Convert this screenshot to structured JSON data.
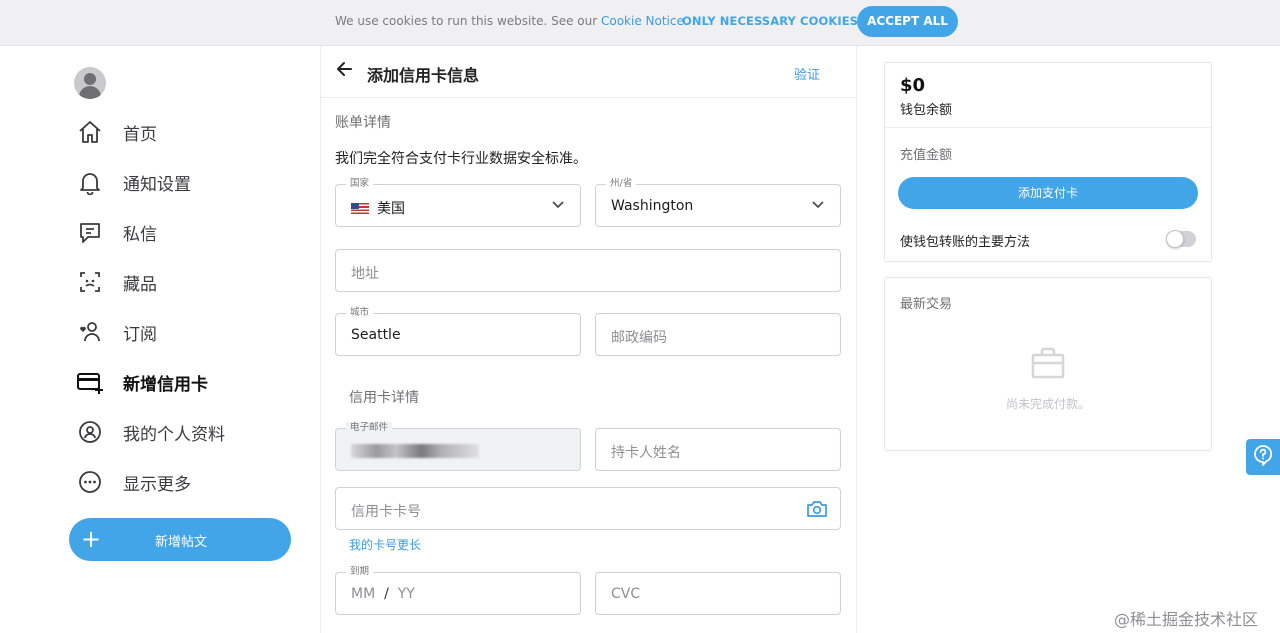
{
  "cookie_banner": {
    "message": "We use cookies to run this website. See our ",
    "notice_link": "Cookie Notice",
    "notice_suffix": ".",
    "only_necessary": "ONLY NECESSARY COOKIES",
    "accept_all": "ACCEPT ALL"
  },
  "sidebar": {
    "items": [
      {
        "label": "首页",
        "icon": "home-icon"
      },
      {
        "label": "通知设置",
        "icon": "bell-icon"
      },
      {
        "label": "私信",
        "icon": "message-icon"
      },
      {
        "label": "藏品",
        "icon": "collection-icon"
      },
      {
        "label": "订阅",
        "icon": "subscription-icon"
      },
      {
        "label": "新增信用卡",
        "icon": "credit-card-add-icon",
        "active": true
      },
      {
        "label": "我的个人资料",
        "icon": "profile-icon"
      },
      {
        "label": "显示更多",
        "icon": "more-icon"
      }
    ],
    "new_post": "新增帖文"
  },
  "main": {
    "title": "添加信用卡信息",
    "verify": "验证",
    "billing_section": "账单详情",
    "compliance": "我们完全符合支付卡行业数据安全标准。",
    "country": {
      "label": "国家",
      "value": "美国"
    },
    "state": {
      "label": "州/省",
      "value": "Washington"
    },
    "address": {
      "placeholder": "地址"
    },
    "city": {
      "label": "城市",
      "value": "Seattle"
    },
    "zip": {
      "placeholder": "邮政编码"
    },
    "card_section": "信用卡详情",
    "email": {
      "label": "电子邮件"
    },
    "holder": {
      "placeholder": "持卡人姓名"
    },
    "card_number": {
      "placeholder": "信用卡卡号"
    },
    "longer_card": "我的卡号更长",
    "expiry": {
      "label": "到期",
      "mm": "MM",
      "sep": "/",
      "yy": "YY"
    },
    "cvc": {
      "placeholder": "CVC"
    }
  },
  "wallet": {
    "amount": "$0",
    "balance_label": "钱包余额",
    "topup_label": "充值金额",
    "add_card": "添加支付卡",
    "primary_method": "使钱包转账的主要方法",
    "primary_enabled": false
  },
  "transactions": {
    "title": "最新交易",
    "empty": "尚未完成付款。"
  },
  "watermark": "@稀土掘金技术社区",
  "colors": {
    "accent": "#42a5e8",
    "link": "#3a9be0"
  }
}
